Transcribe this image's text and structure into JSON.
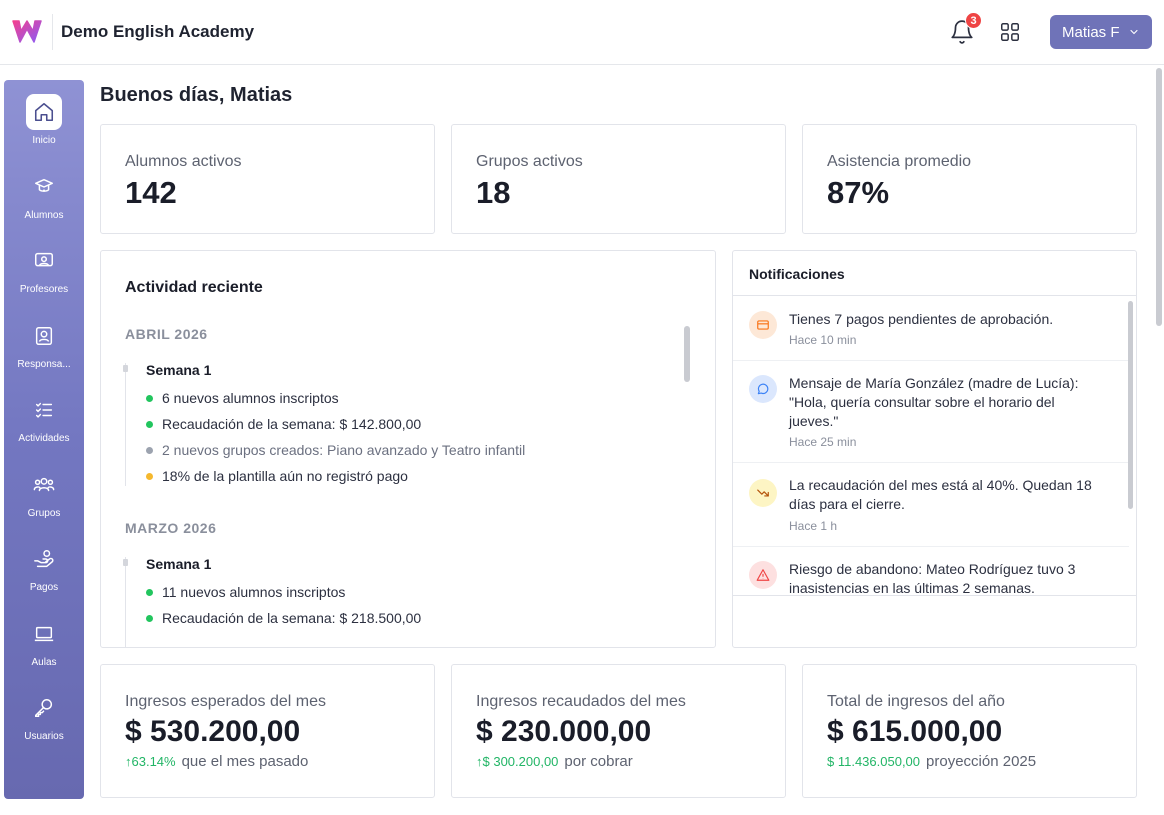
{
  "app": {
    "title": "Demo English Academy"
  },
  "header": {
    "notifications_count": "3",
    "user_label": "Matias F"
  },
  "sidebar": {
    "items": [
      {
        "label": "Inicio",
        "icon": "home-icon",
        "active": true
      },
      {
        "label": "Alumnos",
        "icon": "graduation-cap-icon"
      },
      {
        "label": "Profesores",
        "icon": "presentation-icon"
      },
      {
        "label": "Responsa...",
        "icon": "contact-card-icon"
      },
      {
        "label": "Actividades",
        "icon": "checklist-icon"
      },
      {
        "label": "Grupos",
        "icon": "users-icon"
      },
      {
        "label": "Pagos",
        "icon": "hand-coins-icon"
      },
      {
        "label": "Aulas",
        "icon": "laptop-icon"
      },
      {
        "label": "Usuarios",
        "icon": "key-icon"
      }
    ]
  },
  "main": {
    "greeting": "Buenos días, Matias",
    "stats": [
      {
        "label": "Alumnos activos",
        "value": "142"
      },
      {
        "label": "Grupos activos",
        "value": "18"
      },
      {
        "label": "Asistencia promedio",
        "value": "87%"
      }
    ],
    "activity": {
      "title": "Actividad reciente",
      "months": [
        {
          "name": "ABRIL 2026",
          "week": "Semana 1",
          "items": [
            {
              "text": "6 nuevos alumnos inscriptos",
              "color": "#22c55e"
            },
            {
              "text": "Recaudación de la semana: $ 142.800,00",
              "color": "#22c55e"
            },
            {
              "text": "2 nuevos grupos creados: Piano avanzado y Teatro infantil",
              "color": "#9ca3af"
            },
            {
              "text": "18% de la plantilla aún no registró pago",
              "color": "#f5b82e"
            }
          ]
        },
        {
          "name": "MARZO 2026",
          "week": "Semana 1",
          "items": [
            {
              "text": "11 nuevos alumnos inscriptos",
              "color": "#22c55e"
            },
            {
              "text": "Recaudación de la semana: $ 218.500,00",
              "color": "#22c55e"
            }
          ]
        }
      ]
    },
    "notifications": {
      "title": "Notificaciones",
      "items": [
        {
          "text": "Tienes 7 pagos pendientes de aprobación.",
          "time": "Hace 10 min",
          "icon": "credit-card-icon",
          "color": "#f97316"
        },
        {
          "text": "Mensaje de María González (madre de Lucía): \"Hola, quería consultar sobre el horario del jueves.\"",
          "time": "Hace 25 min",
          "icon": "message-icon",
          "color": "#3b82f6"
        },
        {
          "text": "La recaudación del mes está al 40%. Quedan 18 días para el cierre.",
          "time": "Hace 1 h",
          "icon": "trending-down-icon",
          "color": "#eab308"
        },
        {
          "text": "Riesgo de abandono: Mateo Rodríguez tuvo 3 inasistencias en las últimas 2 semanas.",
          "time": "",
          "icon": "warning-icon",
          "color": "#ef4444"
        }
      ]
    },
    "finance": [
      {
        "label": "Ingresos esperados del mes",
        "value": "$ 530.200,00",
        "sub_value": "63.14%",
        "sub_text": "que el mes pasado",
        "sub_arrow": true
      },
      {
        "label": "Ingresos recaudados del mes",
        "value": "$ 230.000,00",
        "sub_value": "$ 300.200,00",
        "sub_text": "por cobrar",
        "sub_arrow": true
      },
      {
        "label": "Total de ingresos del año",
        "value": "$ 615.000,00",
        "sub_value": "$ 11.436.050,00",
        "sub_text": "proyección 2025",
        "sub_arrow": false
      }
    ]
  }
}
